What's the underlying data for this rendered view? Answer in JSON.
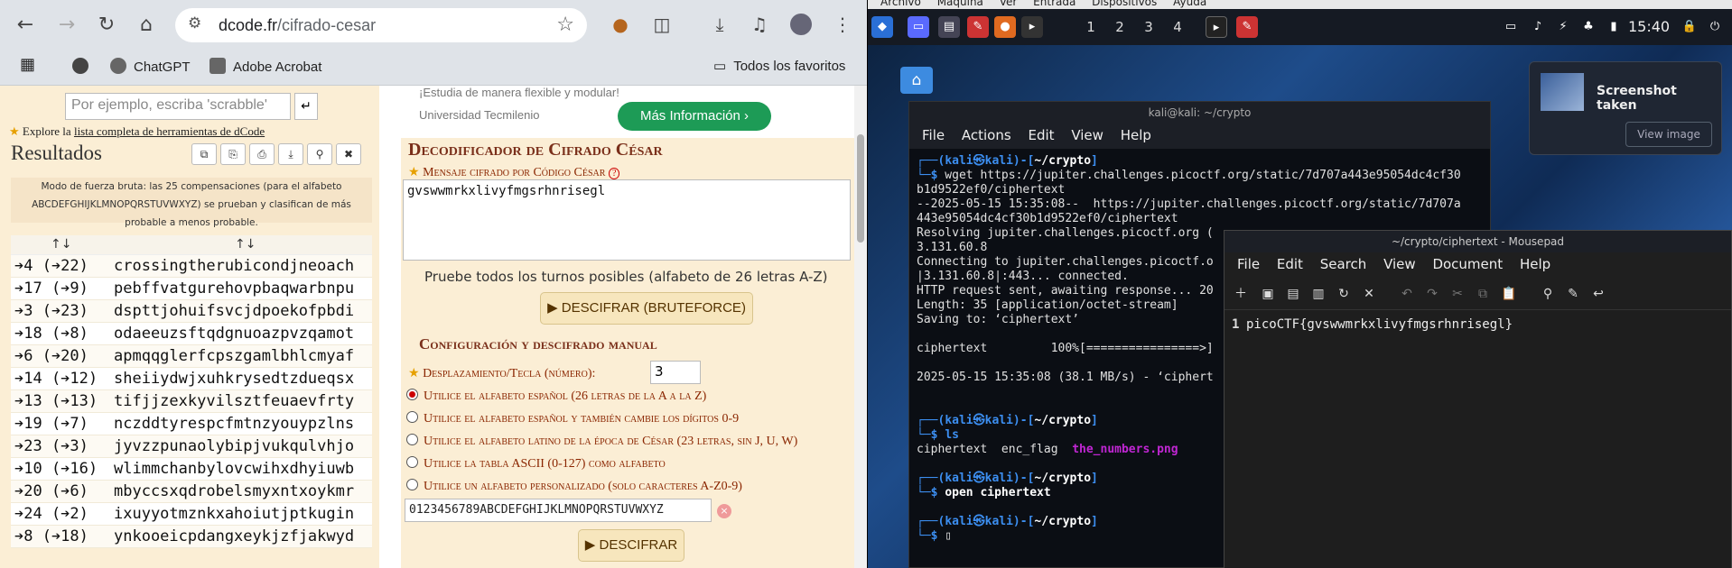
{
  "browser": {
    "url_domain": "dcode.fr",
    "url_path": "/cifrado-cesar",
    "bookmarks": [
      "ChatGPT",
      "Adobe Acrobat"
    ],
    "all_bookmarks": "Todos los favoritos"
  },
  "dcode": {
    "search_placeholder": "Por ejemplo, escriba 'scrabble'",
    "explore_prefix": "Explore la",
    "explore_link": "lista completa de herramientas de dCode",
    "results_title": "Resultados",
    "bruteforce_note": "Modo de fuerza bruta: las 25 compensaciones (para el alfabeto ABCDEFGHIJKLMNOPQRSTUVWXYZ) se prueban y clasifican de más probable a menos probable.",
    "col1": "↑↓",
    "col2": "↑↓",
    "rows": [
      {
        "key": "➔4 (➔22)",
        "text": "crossingtherubicondjneoach"
      },
      {
        "key": "➔17 (➔9)",
        "text": "pebffvatgurehovpbaqwarbnpu"
      },
      {
        "key": "➔3 (➔23)",
        "text": "dspttjohuifsvcjdpoekofpbdi"
      },
      {
        "key": "➔18 (➔8)",
        "text": "odaeeuzsftqdgnuoazpvzqamot"
      },
      {
        "key": "➔6 (➔20)",
        "text": "apmqqglerfcpszgamlbhlcmyaf"
      },
      {
        "key": "➔14 (➔12)",
        "text": "sheiiydwjxuhkrysedtzdueqsx"
      },
      {
        "key": "➔13 (➔13)",
        "text": "tifjjzexkyvilsztfeuaevfrty"
      },
      {
        "key": "➔19 (➔7)",
        "text": "nczddtyrespcfmtnzyouypzlns"
      },
      {
        "key": "➔23 (➔3)",
        "text": "jyvzzpunaolybipjvukqulvhjo"
      },
      {
        "key": "➔10 (➔16)",
        "text": "wlimmchanbylovcwihxdhyiuwb"
      },
      {
        "key": "➔20 (➔6)",
        "text": "mbyccsxqdrobelsmyxntxoykmr"
      },
      {
        "key": "➔24 (➔2)",
        "text": "ixuyyotmznkxahoiutjptkugin"
      },
      {
        "key": "➔8 (➔18)",
        "text": "ynkooeicpdangxeykjzfjakwyd"
      }
    ],
    "ad_top": "¡Estudia de manera flexible y modular!",
    "ad_uni": "Universidad Tecmilenio",
    "ad_button": "Más Información ›",
    "panel_title": "Decodificador de Cifrado César",
    "msg_label": "Mensaje cifrado por Código César",
    "msg_value": "gvswwmrkxlivyfmgsrhnrisegl",
    "try_all": "Pruebe todos los turnos posibles (alfabeto de 26 letras A-Z)",
    "brute_button": "▶ DESCIFRAR (BRUTEFORCE)",
    "config_title": "Configuración y descifrado manual",
    "shift_label": "Desplazamiento/Tecla (número):",
    "shift_value": "3",
    "radios": [
      "Utilice el alfabeto español (26 letras de la A a la Z)",
      "Utilice el alfabeto español y también cambie los dígitos 0-9",
      "Utilice el alfabeto latino de la época de César (23 letras, sin J, U, W)",
      "Utilice la tabla ASCII (0-127) como alfabeto",
      "Utilice un alfabeto personalizado (solo caracteres A-Z0-9)"
    ],
    "custom_alphabet": "0123456789ABCDEFGHIJKLMNOPQRSTUVWXYZ",
    "decrypt_button": "▶ DESCIFRAR"
  },
  "kali": {
    "vm_menu": [
      "Archivo",
      "Máquina",
      "Ver",
      "Entrada",
      "Dispositivos",
      "Ayuda"
    ],
    "workspaces": [
      "1",
      "2",
      "3",
      "4"
    ],
    "clock": "15:40",
    "notif_title": "Screenshot taken",
    "notif_button": "View image",
    "term_title": "kali@kali: ~/crypto",
    "term_menu": [
      "File",
      "Actions",
      "Edit",
      "View",
      "Help"
    ],
    "mouse_title": "~/crypto/ciphertext - Mousepad",
    "mouse_menu": [
      "File",
      "Edit",
      "Search",
      "View",
      "Document",
      "Help"
    ],
    "mouse_line": "1",
    "mouse_text": "picoCTF{gvswwmrkxlivyfmgsrhnrisegl}"
  }
}
